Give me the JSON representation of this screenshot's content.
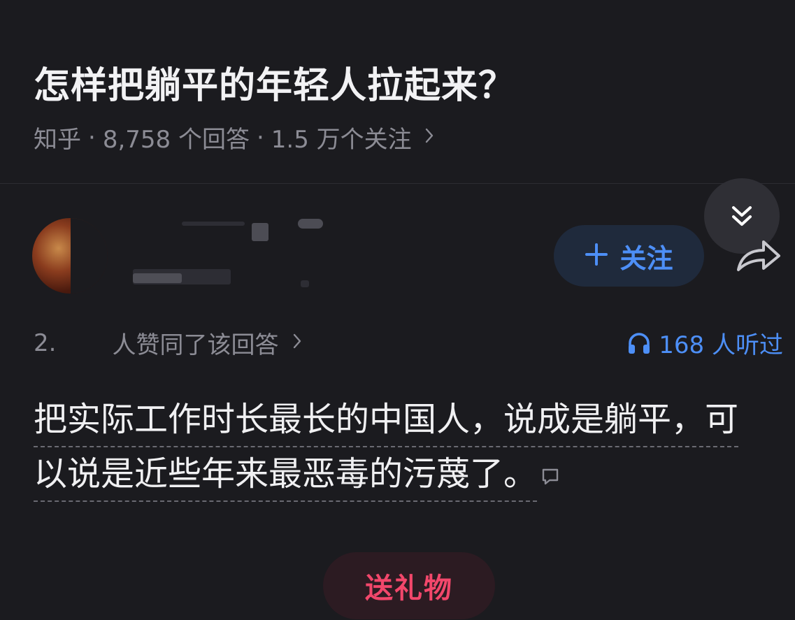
{
  "question": {
    "title": "怎样把躺平的年轻人拉起来？",
    "meta": {
      "source": "知乎",
      "answers": "8,758 个回答",
      "follows": "1.5 万个关注"
    }
  },
  "author": {
    "follow_label": "关注"
  },
  "stats": {
    "upvote_prefix": "2.",
    "upvote_suffix": "人赞同了该回答",
    "listen_count": "168 人听过"
  },
  "answer": {
    "line1": "把实际工作时长最长的中国人，说成是躺平，可",
    "line2": "以说是近些年来最恶毒的污蔑了。"
  },
  "actions": {
    "gift_label": "送礼物"
  },
  "colors": {
    "background": "#1b1b1f",
    "accent_blue": "#4d8ff7",
    "gift_red": "#f2476b"
  },
  "icons": [
    "double-chevron-down-icon",
    "plus-icon",
    "share-icon",
    "headphones-icon",
    "comment-icon",
    "chevron-right-icon"
  ]
}
